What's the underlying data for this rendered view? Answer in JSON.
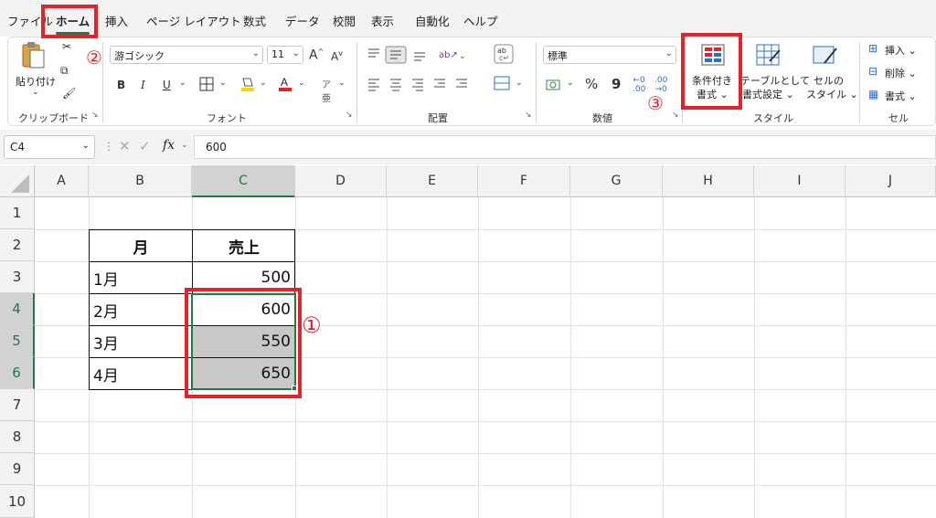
{
  "menu_tabs": [
    "ファイル",
    "ホーム",
    "挿入",
    "ページ レイアウト",
    "数式",
    "データ",
    "校閲",
    "表示",
    "自動化",
    "ヘルプ"
  ],
  "active_tab": "ホーム",
  "ribbon": {
    "clipboard": {
      "paste_label": "貼り付け",
      "group_label": "クリップボード"
    },
    "font": {
      "font_name": "游ゴシック",
      "font_size": "11",
      "grow": "A",
      "shrink": "A",
      "bold": "B",
      "italic": "I",
      "underline": "U",
      "group_label": "フォント"
    },
    "alignment": {
      "group_label": "配置"
    },
    "number": {
      "format": "標準",
      "percent": "%",
      "comma": "9",
      "group_label": "数値"
    },
    "styles": {
      "conditional_label_1": "条件付き",
      "conditional_label_2": "書式",
      "table_label_1": "テーブルとして",
      "table_label_2": "書式設定",
      "cell_style_label_1": "セルの",
      "cell_style_label_2": "スタイル",
      "group_label": "スタイル"
    },
    "cells": {
      "insert": "挿入",
      "delete": "削除",
      "format": "書式",
      "group_label": "セル"
    }
  },
  "formula_bar": {
    "name_box": "C4",
    "fx": "fx",
    "value": "600"
  },
  "columns": [
    "A",
    "B",
    "C",
    "D",
    "E",
    "F",
    "G",
    "H",
    "I",
    "J"
  ],
  "rows": [
    "1",
    "2",
    "3",
    "4",
    "5",
    "6",
    "7",
    "8",
    "9",
    "10"
  ],
  "table": {
    "headers": [
      "月",
      "売上"
    ],
    "rows": [
      [
        "1月",
        "500"
      ],
      [
        "2月",
        "600"
      ],
      [
        "3月",
        "550"
      ],
      [
        "4月",
        "650"
      ]
    ]
  },
  "annotations": [
    "①",
    "②",
    "③"
  ],
  "colors": {
    "accent": "#1f7a46",
    "highlight": "#e3222b",
    "selection": "#c8c8c8"
  }
}
